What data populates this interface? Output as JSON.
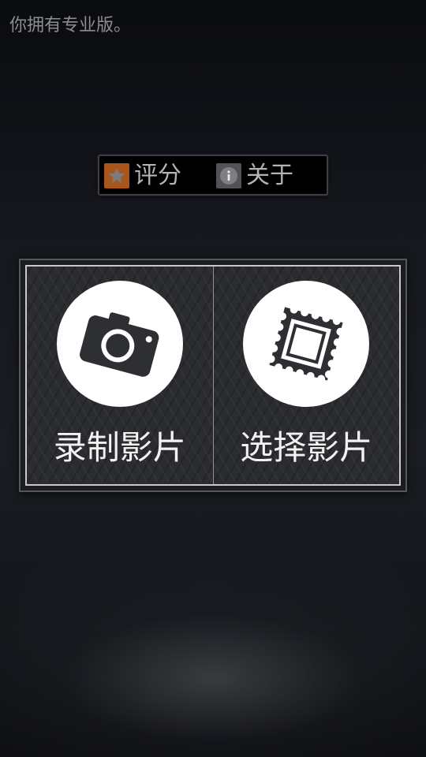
{
  "status": {
    "pro_message": "你拥有专业版。"
  },
  "top_menu": {
    "rate_label": "评分",
    "rate_icon": "star-icon",
    "about_label": "关于",
    "about_icon": "info-icon"
  },
  "actions": {
    "record": {
      "label": "录制影片",
      "icon": "camera-icon"
    },
    "select": {
      "label": "选择影片",
      "icon": "photo-frame-icon"
    }
  },
  "colors": {
    "rate_accent": "#a8561b",
    "about_accent": "#515357",
    "tile_bg": "#2b2c2f",
    "label_text": "#f2f2f2"
  }
}
